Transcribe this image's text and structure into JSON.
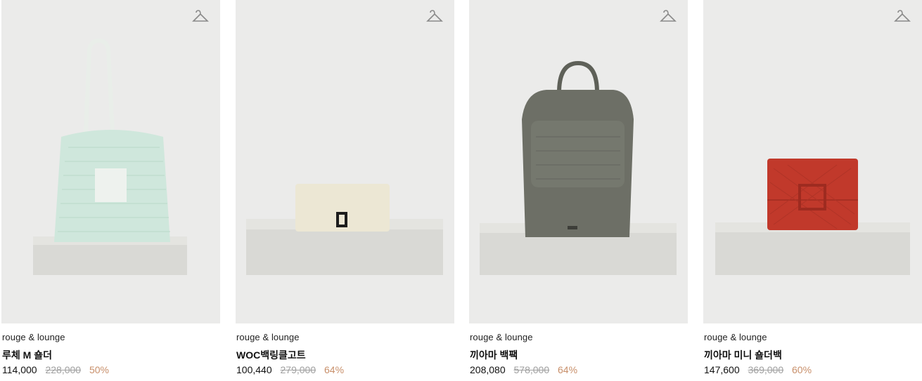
{
  "products": [
    {
      "brand": "rouge & lounge",
      "name": "루체 M 숄더",
      "sale_price": "114,000",
      "original_price": "228,000",
      "discount": "50%",
      "icon": "hanger-icon"
    },
    {
      "brand": "rouge & lounge",
      "name": "WOC백링클고트",
      "sale_price": "100,440",
      "original_price": "279,000",
      "discount": "64%",
      "icon": "hanger-icon"
    },
    {
      "brand": "rouge & lounge",
      "name": "끼아마 백팩",
      "sale_price": "208,080",
      "original_price": "578,000",
      "discount": "64%",
      "icon": "hanger-icon"
    },
    {
      "brand": "rouge & lounge",
      "name": "끼아마 미니 숄더백",
      "sale_price": "147,600",
      "original_price": "369,000",
      "discount": "60%",
      "icon": "hanger-icon"
    }
  ],
  "colors": {
    "photo_bg": "#ebebea",
    "discount": "#c88f6a",
    "original_price": "#a0a0a0",
    "tote": "#cfe7dc",
    "clutch": "#ece7d4",
    "backpack": "#6d6f66",
    "wallet": "#c1392b",
    "pedestal": "#d8d8d4"
  }
}
